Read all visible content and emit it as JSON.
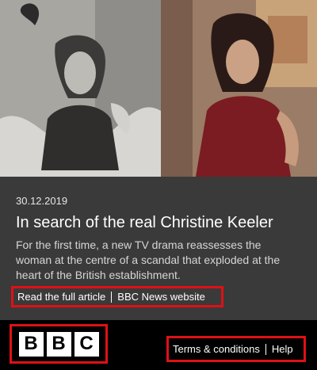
{
  "hero": {
    "left_image": "black-and-white portrait of Christine Keeler",
    "right_image": "actress portraying Christine Keeler in TV drama"
  },
  "article": {
    "date": "30.12.2019",
    "headline": "In search of the real Christine Keeler",
    "summary": "For the first time, a new TV drama reassesses the woman at the centre of a scandal that exploded at the heart of the British establishment.",
    "links": {
      "read_full": "Read the full article",
      "website": "BBC News website"
    }
  },
  "footer": {
    "logo_letters": [
      "B",
      "B",
      "C"
    ],
    "terms": "Terms & conditions",
    "help": "Help"
  },
  "colors": {
    "accent": "#e01016",
    "article_bg": "#3a3a3a",
    "footer_bg": "#000000"
  }
}
